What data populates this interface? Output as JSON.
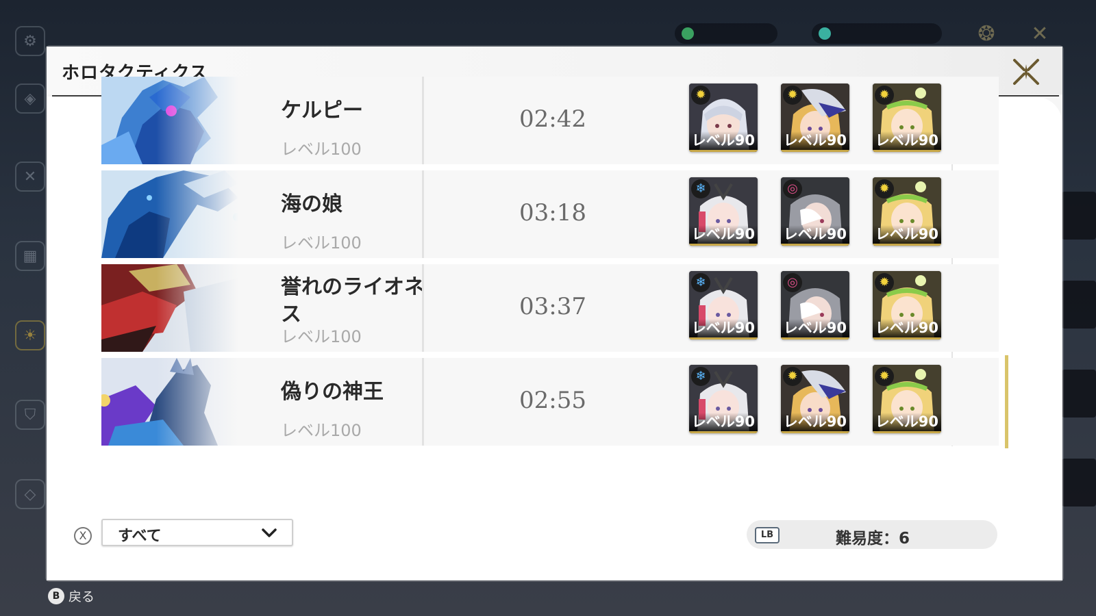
{
  "modal": {
    "title": "ホロタクティクス"
  },
  "bosses": [
    {
      "name": "ケルピー",
      "level": "レベル100",
      "time": "02:42",
      "team": [
        {
          "element": "sun-icon",
          "level": "レベル90"
        },
        {
          "element": "sun-icon",
          "level": "レベル90"
        },
        {
          "element": "sun-icon",
          "level": "レベル90"
        }
      ]
    },
    {
      "name": "海の娘",
      "level": "レベル100",
      "time": "03:18",
      "team": [
        {
          "element": "snowflake-icon",
          "level": "レベル90"
        },
        {
          "element": "spiral-icon",
          "level": "レベル90"
        },
        {
          "element": "sun-icon",
          "level": "レベル90"
        }
      ]
    },
    {
      "name": "誉れのライオネス",
      "level": "レベル100",
      "time": "03:37",
      "team": [
        {
          "element": "snowflake-icon",
          "level": "レベル90"
        },
        {
          "element": "spiral-icon",
          "level": "レベル90"
        },
        {
          "element": "sun-icon",
          "level": "レベル90"
        }
      ]
    },
    {
      "name": "偽りの神王",
      "level": "レベル100",
      "time": "02:55",
      "team": [
        {
          "element": "snowflake-icon",
          "level": "レベル90"
        },
        {
          "element": "sun-icon",
          "level": "レベル90"
        },
        {
          "element": "sun-icon",
          "level": "レベル90"
        }
      ]
    }
  ],
  "footer": {
    "x_button": "X",
    "filter_value": "すべて",
    "lb_button": "LB",
    "difficulty_label": "難易度：6"
  },
  "back": {
    "button": "B",
    "label": "戻る"
  },
  "colors": {
    "accent_gold": "#c8a848",
    "selected_bar": "#d9c46a",
    "element_sun": "#f2d23c",
    "element_ice": "#5bb8ff",
    "element_spiral": "#e0508a"
  }
}
